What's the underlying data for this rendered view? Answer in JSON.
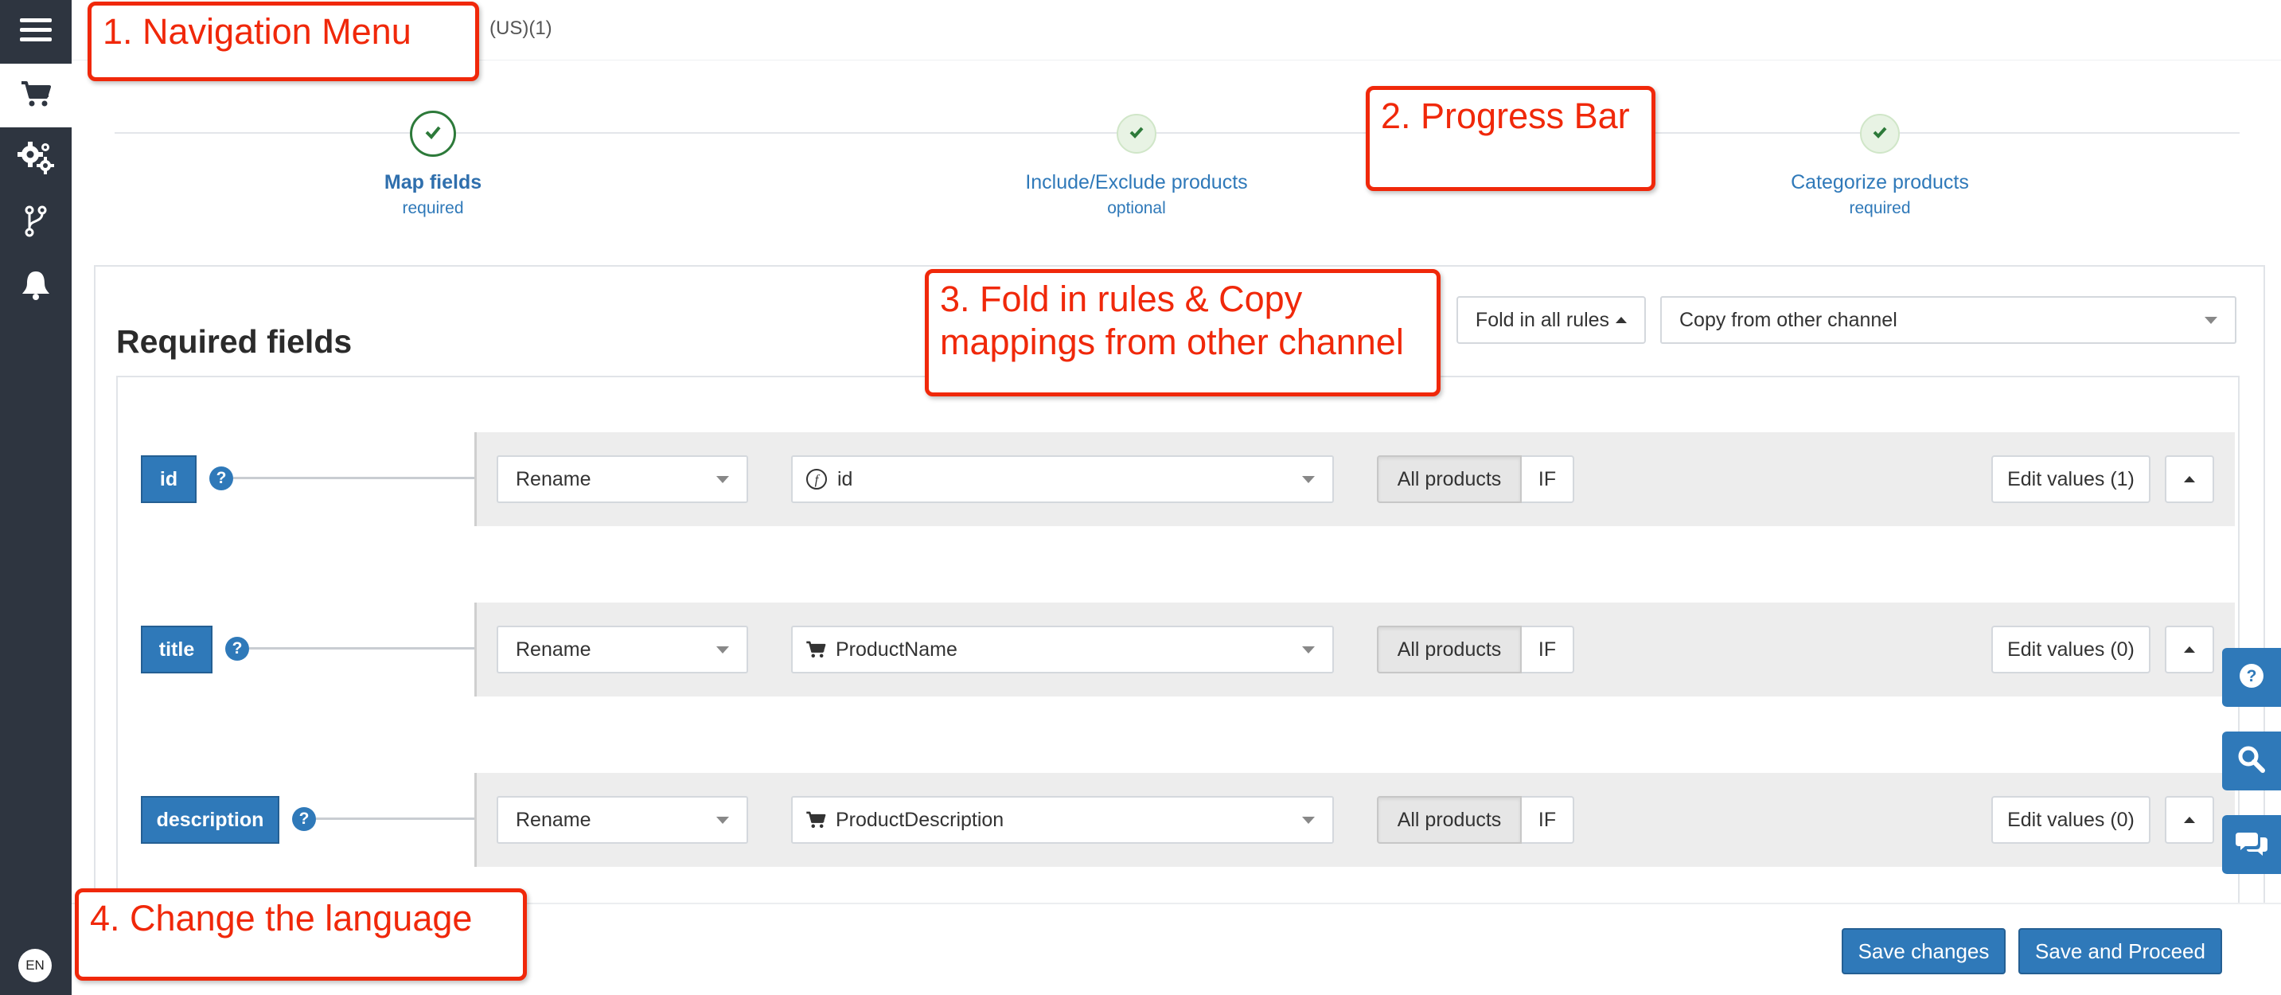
{
  "sidebar": {
    "items": [
      {
        "icon": "menu-icon"
      },
      {
        "icon": "cart-icon"
      },
      {
        "icon": "gears-icon"
      },
      {
        "icon": "branch-icon"
      },
      {
        "icon": "bell-icon"
      }
    ],
    "language": "EN"
  },
  "header": {
    "account_suffix": "(US)(1)"
  },
  "steps": [
    {
      "title": "Map fields",
      "subtitle": "required",
      "state": "active"
    },
    {
      "title": "Include/Exclude products",
      "subtitle": "optional",
      "state": "done"
    },
    {
      "title": "Categorize products",
      "subtitle": "required",
      "state": "done"
    }
  ],
  "section": {
    "title": "Required fields",
    "fold_label": "Fold in all rules",
    "copy_label": "Copy from other channel"
  },
  "rows": [
    {
      "field": "id",
      "action": "Rename",
      "source": "id",
      "source_icon": "function-icon",
      "scope": "All products",
      "condition": "IF",
      "edit_label": "Edit values (1)"
    },
    {
      "field": "title",
      "action": "Rename",
      "source": "ProductName",
      "source_icon": "cart-icon",
      "scope": "All products",
      "condition": "IF",
      "edit_label": "Edit values (0)"
    },
    {
      "field": "description",
      "action": "Rename",
      "source": "ProductDescription",
      "source_icon": "cart-icon",
      "scope": "All products",
      "condition": "IF",
      "edit_label": "Edit values (0)"
    }
  ],
  "help_symbol": "?",
  "footer": {
    "save_label": "Save changes",
    "proceed_label": "Save and Proceed"
  },
  "floating_tools": [
    "help-icon",
    "search-icon",
    "chat-icon"
  ],
  "annotations": {
    "nav": "1. Navigation Menu",
    "progress": "2. Progress Bar",
    "fold_line1": "3. Fold in rules & Copy",
    "fold_line2": "mappings from other channel",
    "language": "4. Change the language"
  },
  "colors": {
    "sidebar": "#2e3540",
    "primary": "#2f79b9",
    "annotation": "#f0280a",
    "step_check": "#2d7a3a"
  }
}
